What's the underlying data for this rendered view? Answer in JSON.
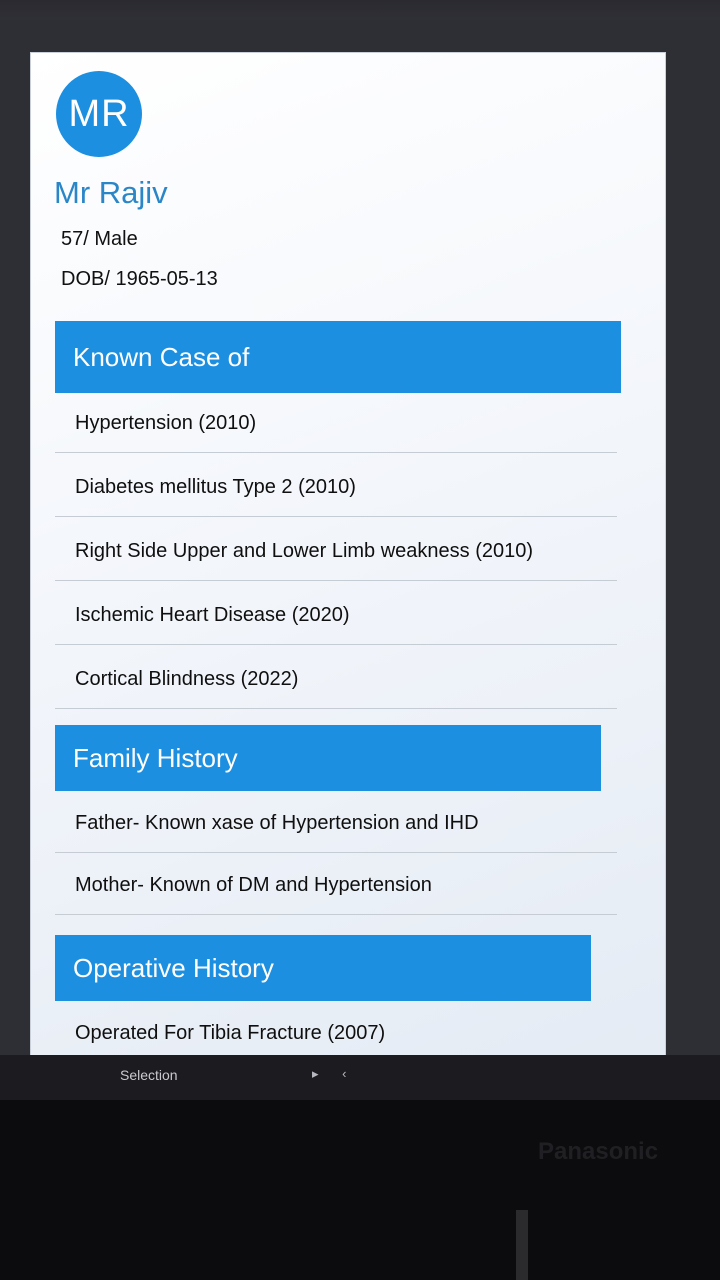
{
  "patient": {
    "initials": "MR",
    "name": "Mr Rajiv",
    "age_sex": "57/ Male",
    "dob": "DOB/ 1965-05-13"
  },
  "known_case": {
    "title": "Known Case of",
    "items": [
      "Hypertension (2010)",
      "Diabetes mellitus Type 2 (2010)",
      "Right Side Upper and Lower Limb weakness (2010)",
      "Ischemic Heart Disease (2020)",
      "Cortical Blindness (2022)"
    ]
  },
  "family_history": {
    "title": "Family History",
    "items": [
      "Father- Known xase of Hypertension and IHD",
      "Mother- Known of DM and Hypertension"
    ]
  },
  "operative_history": {
    "title": "Operative History",
    "items": [
      "Operated For Tibia Fracture (2007)"
    ]
  },
  "taskbar": {
    "selection_label": "Selection",
    "arrows": "▸ ‹"
  },
  "monitor": {
    "brand": "Panasonic"
  },
  "colors": {
    "accent": "#1d8fe1",
    "name_text": "#2b86c8"
  }
}
